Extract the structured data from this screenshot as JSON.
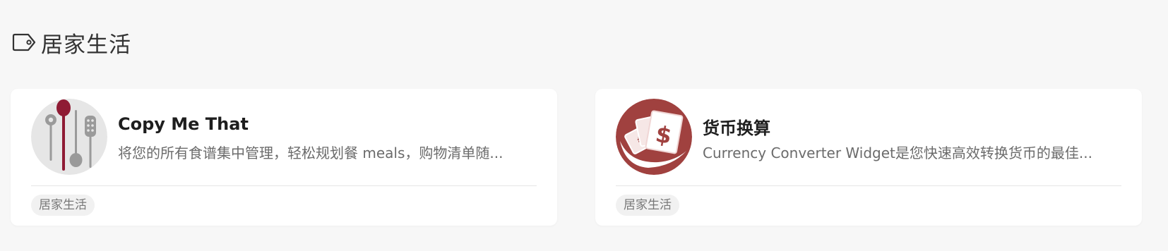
{
  "section": {
    "icon": "tag-icon",
    "title": "居家生活"
  },
  "cards": [
    {
      "icon": "cooking-utensils-icon",
      "title": "Copy Me That",
      "description": "将您的所有食谱集中管理，轻松规划餐 meals，购物清单随...",
      "tag": "居家生活",
      "accent_color": "#8f1b34"
    },
    {
      "icon": "currency-exchange-icon",
      "title": "货币换算",
      "description": "Currency Converter Widget是您快速高效转换货币的最佳...",
      "tag": "居家生活",
      "accent_color": "#a0413f"
    }
  ]
}
